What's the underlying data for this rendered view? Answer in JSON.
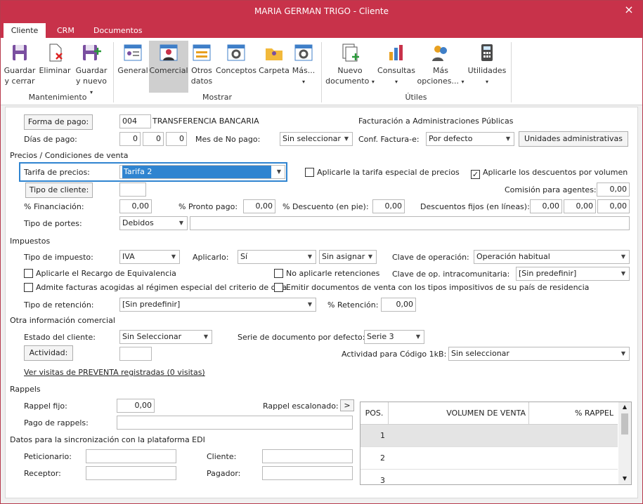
{
  "window": {
    "title": "MARIA GERMAN TRIGO - Cliente",
    "close_icon": "×"
  },
  "tabs": [
    {
      "label": "Cliente"
    },
    {
      "label": "CRM"
    },
    {
      "label": "Documentos"
    }
  ],
  "ribbon": {
    "save_close": [
      "Guardar",
      "y cerrar"
    ],
    "delete": "Eliminar",
    "save_new": [
      "Guardar",
      "y nuevo"
    ],
    "general": "General",
    "commercial": "Comercial",
    "other_data": [
      "Otros",
      "datos"
    ],
    "concepts": "Conceptos",
    "folder": "Carpeta",
    "more": "Más...",
    "new_document": [
      "Nuevo",
      "documento"
    ],
    "queries": "Consultas",
    "more_options": [
      "Más",
      "opciones..."
    ],
    "utilities": "Utilidades",
    "groups": {
      "maintenance": "Mantenimiento",
      "show": "Mostrar",
      "utils": "Útiles"
    }
  },
  "payment": {
    "button": "Forma de pago:",
    "code": "004",
    "name": "TRANSFERENCIA BANCARIA",
    "days_label": "Días de pago:",
    "days": [
      "0",
      "0",
      "0"
    ],
    "no_pay_month_label": "Mes de No pago:",
    "no_pay_month": "Sin seleccionar"
  },
  "public_admin": {
    "title": "Facturación a Administraciones Públicas",
    "conf_label": "Conf. Factura-e:",
    "conf_value": "Por defecto",
    "units_button": "Unidades administrativas"
  },
  "prices": {
    "section": "Precios / Condiciones de venta",
    "rate_label": "Tarifa de precios:",
    "rate_value": "Tarifa 2",
    "apply_special_rate": "Aplicarle la tarifa especial de precios",
    "apply_volume_discounts": "Aplicarle los descuentos por volumen",
    "client_type_button": "Tipo de cliente:",
    "agent_commission_label": "Comisión para agentes:",
    "agent_commission": "0,00",
    "financing_label": "% Financiación:",
    "financing": "0,00",
    "prompt_payment_label": "% Pronto pago:",
    "prompt_payment": "0,00",
    "discount_label": "% Descuento (en pie):",
    "discount": "0,00",
    "fixed_discounts_label": "Descuentos fijos (en líneas):",
    "fixed_discounts": [
      "0,00",
      "0,00",
      "0,00"
    ],
    "shipping_label": "Tipo de portes:",
    "shipping_value": "Debidos"
  },
  "taxes": {
    "section": "Impuestos",
    "tax_type_label": "Tipo de impuesto:",
    "tax_type": "IVA",
    "apply_label": "Aplicarlo:",
    "apply_value": "Sí",
    "assign_value": "Sin asignar",
    "op_key_label": "Clave de operación:",
    "op_key": "Operación habitual",
    "equivalence": "Aplicarle el Recargo de Equivalencia",
    "no_withholding": "No aplicarle retenciones",
    "intra_key_label": "Clave de op. intracomunitaria:",
    "intra_key": "[Sin predefinir]",
    "cash_criteria": "Admite facturas acogidas al régimen especial del criterio de caja",
    "issue_docs": "Emitir documentos de venta con los tipos impositivos de su país de residencia",
    "withholding_type_label": "Tipo de retención:",
    "withholding_type": "[Sin predefinir]",
    "withholding_pct_label": "% Retención:",
    "withholding_pct": "0,00"
  },
  "other": {
    "section": "Otra información comercial",
    "status_label": "Estado del cliente:",
    "status": "Sin Seleccionar",
    "series_label": "Serie de documento por defecto:",
    "series": "Serie 3",
    "activity_button": "Actividad:",
    "code1kb_label": "Actividad para Código 1kB:",
    "code1kb": "Sin seleccionar",
    "presale_link": "Ver visitas de PREVENTA registradas (0 visitas)"
  },
  "rappels": {
    "section": "Rappels",
    "fixed_label": "Rappel fijo:",
    "fixed": "0,00",
    "tiered_label": "Rappel escalonado:",
    "tiered_button": ">",
    "payment_label": "Pago de rappels:",
    "table_headers": [
      "POS.",
      "VOLUMEN DE VENTA",
      "% RAPPEL"
    ],
    "rows": [
      {
        "pos": "1"
      },
      {
        "pos": "2"
      },
      {
        "pos": "3"
      }
    ]
  },
  "edi": {
    "section": "Datos para la sincronización con la plataforma EDI",
    "petitioner_label": "Peticionario:",
    "client_label": "Cliente:",
    "receiver_label": "Receptor:",
    "payer_label": "Pagador:"
  }
}
